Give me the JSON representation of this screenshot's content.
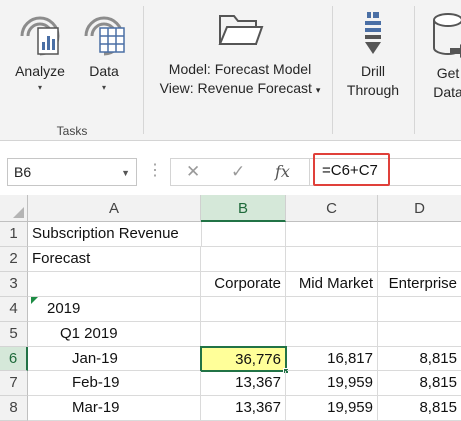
{
  "ribbon": {
    "analyze_label": "Analyze",
    "data_label": "Data",
    "model_line": "Model: Forecast Model",
    "view_line": "View: Revenue Forecast",
    "drill_line1": "Drill",
    "drill_line2": "Through",
    "get_data_line1": "Get",
    "get_data_line2": "Data",
    "group_tasks": "Tasks",
    "caret": "▾",
    "view_caret": "▾",
    "accent": "#4a6fa5"
  },
  "formula_bar": {
    "name_box": "B6",
    "formula": "=C6+C7",
    "cancel_glyph": "✕",
    "enter_glyph": "✓",
    "fx_glyph": "fx",
    "dots": "⋮",
    "highlight_color": "#e0403a"
  },
  "grid": {
    "columns": [
      "A",
      "B",
      "C",
      "D"
    ],
    "rows": [
      "1",
      "2",
      "3",
      "4",
      "5",
      "6",
      "7",
      "8"
    ],
    "cells": {
      "a1": "Subscription Revenue",
      "a2": "Forecast",
      "b3": "Corporate",
      "c3": "Mid Market",
      "d3": "Enterprise",
      "a4": "2019",
      "a5": "Q1 2019",
      "a6": "Jan-19",
      "b6": "36,776",
      "c6": "16,817",
      "d6": "8,815",
      "a7": "Feb-19",
      "b7": "13,367",
      "c7": "19,959",
      "d7": "8,815",
      "a8": "Mar-19",
      "b8": "13,367",
      "c8": "19,959",
      "d8": "8,815"
    },
    "active_cell_fill": "#ffff99",
    "selection_color": "#217346"
  }
}
